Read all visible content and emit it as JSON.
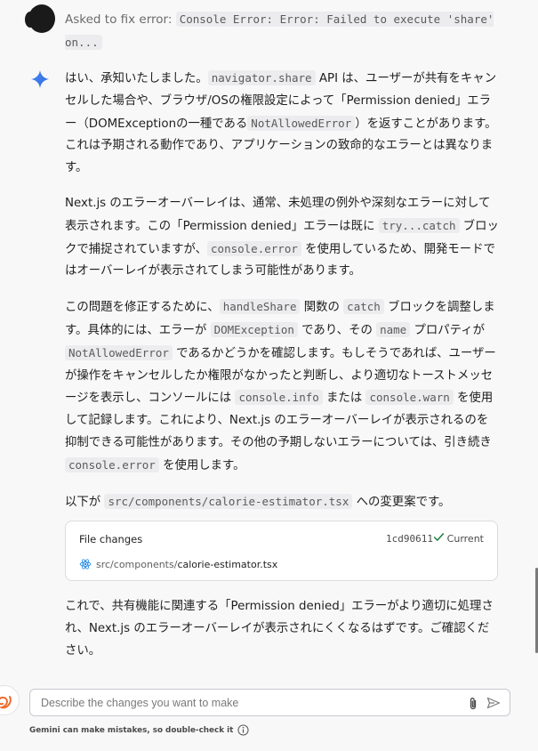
{
  "user_message": {
    "prefix": "Asked to fix error: ",
    "error_code": "Console Error: Error: Failed to execute 'share' on..."
  },
  "assistant": {
    "p1": [
      {
        "t": "text",
        "v": "はい、承知いたしました。"
      },
      {
        "t": "code",
        "v": "navigator.share"
      },
      {
        "t": "text",
        "v": " API は、ユーザーが共有をキャンセルした場合や、ブラウザ/OSの権限設定によって「Permission denied」エラー（DOMExceptionの一種である"
      },
      {
        "t": "code",
        "v": "NotAllowedError"
      },
      {
        "t": "text",
        "v": "）を返すことがあります。これは予期される動作であり、アプリケーションの致命的なエラーとは異なります。"
      }
    ],
    "p2": [
      {
        "t": "text",
        "v": "Next.js のエラーオーバーレイは、通常、未処理の例外や深刻なエラーに対して表示されます。この「Permission denied」エラーは既に "
      },
      {
        "t": "code",
        "v": "try...catch"
      },
      {
        "t": "text",
        "v": " ブロックで捕捉されていますが、"
      },
      {
        "t": "code",
        "v": "console.error"
      },
      {
        "t": "text",
        "v": " を使用しているため、開発モードではオーバーレイが表示されてしまう可能性があります。"
      }
    ],
    "p3": [
      {
        "t": "text",
        "v": "この問題を修正するために、"
      },
      {
        "t": "code",
        "v": "handleShare"
      },
      {
        "t": "text",
        "v": " 関数の "
      },
      {
        "t": "code",
        "v": "catch"
      },
      {
        "t": "text",
        "v": " ブロックを調整します。具体的には、エラーが "
      },
      {
        "t": "code",
        "v": "DOMException"
      },
      {
        "t": "text",
        "v": " であり、その "
      },
      {
        "t": "code",
        "v": "name"
      },
      {
        "t": "text",
        "v": " プロパティが "
      },
      {
        "t": "code",
        "v": "NotAllowedError"
      },
      {
        "t": "text",
        "v": " であるかどうかを確認します。もしそうであれば、ユーザーが操作をキャンセルしたか権限がなかったと判断し、より適切なトーストメッセージを表示し、コンソールには "
      },
      {
        "t": "code",
        "v": "console.info"
      },
      {
        "t": "text",
        "v": " または "
      },
      {
        "t": "code",
        "v": "console.warn"
      },
      {
        "t": "text",
        "v": " を使用して記録します。これにより、Next.js のエラーオーバーレイが表示されるのを抑制できる可能性があります。その他の予期しないエラーについては、引き続き "
      },
      {
        "t": "code",
        "v": "console.error"
      },
      {
        "t": "text",
        "v": " を使用します。"
      }
    ],
    "p4": [
      {
        "t": "text",
        "v": "以下が "
      },
      {
        "t": "code",
        "v": "src/components/calorie-estimator.tsx"
      },
      {
        "t": "text",
        "v": " への変更案です。"
      }
    ],
    "closing": "これで、共有機能に関連する「Permission denied」エラーがより適切に処理され、Next.js のエラーオーバーレイが表示されにくくなるはずです。ご確認ください。"
  },
  "file_card": {
    "title": "File changes",
    "hash": "1cd90611",
    "status": "Current",
    "file_dir": "src/components/",
    "file_name": "calorie-estimator.tsx"
  },
  "input": {
    "placeholder": "Describe the changes you want to make"
  },
  "disclaimer": "Gemini can make mistakes, so double-check it",
  "colors": {
    "accent_green": "#188038",
    "gemini_blue": "#4a86f0",
    "react_blue": "#1e88e5"
  }
}
